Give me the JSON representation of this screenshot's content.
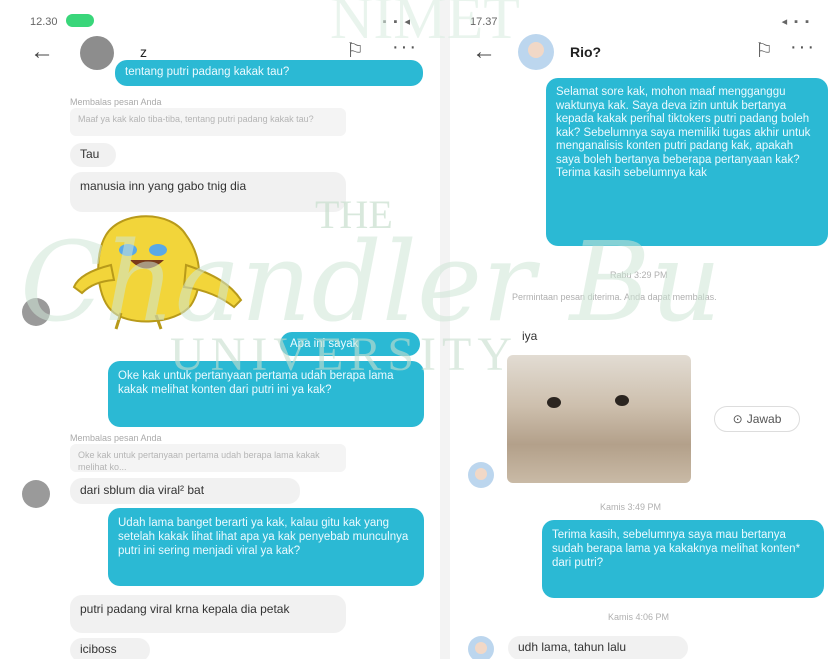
{
  "left": {
    "status": {
      "time": "12.30",
      "icons": "▪ ▪ ◂"
    },
    "header": {
      "contact": "z"
    },
    "messages": {
      "m1": "tentang putri padang kakak tau?",
      "reply1_label": "Membalas pesan Anda",
      "reply1_quote": "Maaf ya kak kalo tiba-tiba, tentang putri padang kakak tau?",
      "m2": "Tau",
      "m3": "manusia inn yang gabo tnig dia",
      "m4": "Apa ini sayak",
      "m5": "Oke kak untuk pertanyaan pertama udah berapa lama kakak melihat konten dari putri ini ya kak?",
      "reply2_label": "Membalas pesan Anda",
      "reply2_quote": "Oke kak untuk pertanyaan pertama udah berapa lama kakak melihat ko...",
      "m6": "dari sblum dia viral² bat",
      "m7": "Udah lama banget berarti ya kak, kalau gitu kak yang setelah kakak lihat lihat apa ya kak penyebab munculnya putri ini sering menjadi viral ya kak?",
      "m8": "putri padang viral krna kepala dia petak",
      "m9": "iciboss"
    }
  },
  "right": {
    "status": {
      "time": "17.37",
      "icons": "◂ ▪ ▪"
    },
    "header": {
      "contact": "Rio?"
    },
    "messages": {
      "m1": "Selamat sore kak, mohon maaf mengganggu waktunya kak. Saya deva izin untuk bertanya kepada kakak perihal tiktokers putri padang boleh kak? Sebelumnya saya memiliki tugas akhir untuk menganalisis konten putri padang kak, apakah saya boleh bertanya beberapa pertanyaan kak? Terima kasih sebelumnya kak",
      "ts1": "Rabu 3:29 PM",
      "note": "Permintaan pesan diterima. Anda dapat membalas.",
      "m2": "iya",
      "jawab": "Jawab",
      "ts2": "Kamis 3:49 PM",
      "m3": "Terima kasih, sebelumnya saya mau bertanya sudah berapa lama ya kakaknya melihat konten* dari putri?",
      "ts3": "Kamis 4:06 PM",
      "m4": "udh lama, tahun lalu"
    }
  },
  "watermark": {
    "top": "NIMET",
    "middle": "THE",
    "script": "Chandler Bu",
    "bottom": "UNIVERSITY"
  }
}
